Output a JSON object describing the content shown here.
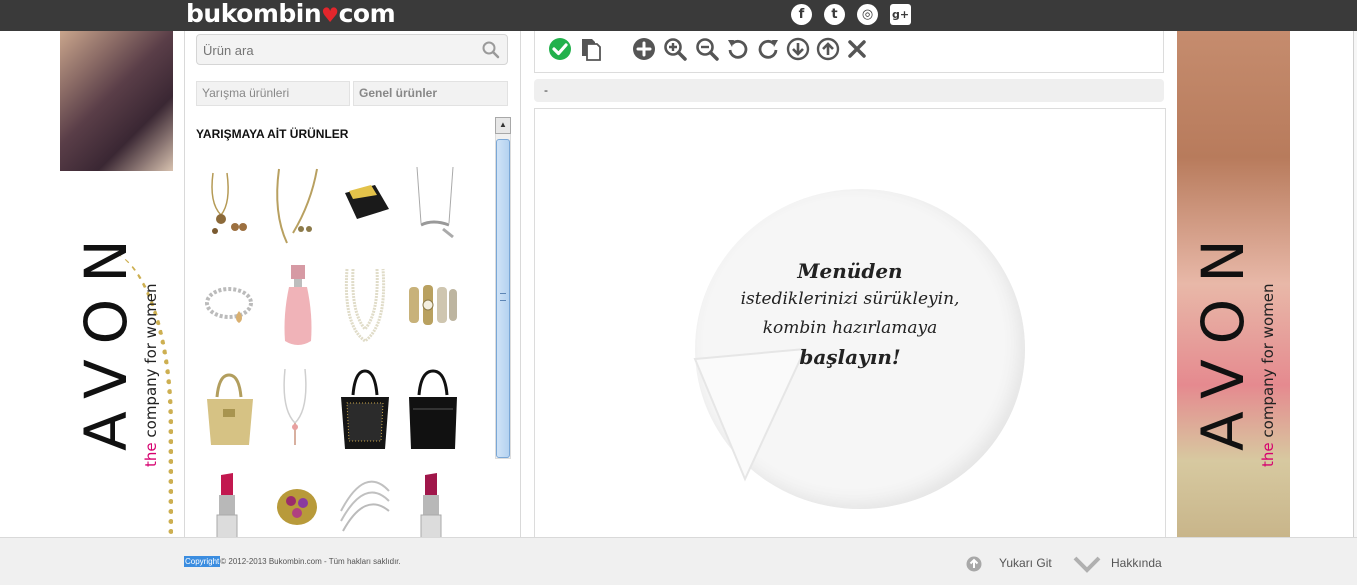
{
  "header": {
    "logo": {
      "part1": "bukombin",
      "heart": "♥",
      "part2": "com"
    },
    "social": [
      {
        "icon": "facebook-icon",
        "glyph": "f"
      },
      {
        "icon": "twitter-icon",
        "glyph": "t"
      },
      {
        "icon": "instagram-icon",
        "glyph": "◎"
      },
      {
        "icon": "google-plus-icon",
        "glyph": "g+"
      }
    ]
  },
  "banner": {
    "brand": "AVON",
    "the": "the",
    "tagline": " company for women"
  },
  "sidebar": {
    "search_placeholder": "Ürün ara",
    "tabs": [
      "Yarışma ürünleri",
      "Genel ürünler"
    ],
    "section_title": "YARIŞMAYA AİT ÜRÜNLER",
    "products": [
      {
        "icon": "necklace-earring-set-icon"
      },
      {
        "icon": "gold-necklace-set-icon"
      },
      {
        "icon": "wallet-icon"
      },
      {
        "icon": "silver-necklace-icon"
      },
      {
        "icon": "charm-bracelet-icon"
      },
      {
        "icon": "perfume-bottle-icon"
      },
      {
        "icon": "pearl-necklace-icon"
      },
      {
        "icon": "watch-bangle-set-icon"
      },
      {
        "icon": "beige-handbag-icon"
      },
      {
        "icon": "pendant-necklace-icon"
      },
      {
        "icon": "black-handbag-icon"
      },
      {
        "icon": "black-tote-bag-icon"
      },
      {
        "icon": "lipstick-icon"
      },
      {
        "icon": "gem-ring-icon"
      },
      {
        "icon": "multi-strand-necklace-icon"
      },
      {
        "icon": "lipstick-icon"
      }
    ]
  },
  "toolbar": {
    "tools": [
      {
        "name": "confirm-button",
        "icon": "check-icon"
      },
      {
        "name": "copy-button",
        "icon": "copy-icon"
      },
      {
        "name": "add-button",
        "icon": "plus-icon"
      },
      {
        "name": "zoom-in-button",
        "icon": "zoom-in-icon"
      },
      {
        "name": "zoom-out-button",
        "icon": "zoom-out-icon"
      },
      {
        "name": "rotate-left-button",
        "icon": "rotate-left-icon"
      },
      {
        "name": "rotate-right-button",
        "icon": "rotate-right-icon"
      },
      {
        "name": "send-backward-button",
        "icon": "arrow-down-icon"
      },
      {
        "name": "bring-forward-button",
        "icon": "arrow-up-icon"
      },
      {
        "name": "delete-button",
        "icon": "close-icon"
      }
    ],
    "status": "-"
  },
  "canvas": {
    "line1": "Menüden",
    "line2": "istediklerinizi sürükleyin,",
    "line3": "kombin hazırlamaya",
    "line4": "başlayın!"
  },
  "footer": {
    "copyright_word": "Copyright",
    "copyright_rest": "© 2012-2013 Bukombin.com - Tüm hakları saklıdır.",
    "back_to_top": "Yukarı Git",
    "about": "Hakkında"
  },
  "colors": {
    "topbar": "#3a3a3a",
    "accent_green": "#22b14c",
    "icon_gray": "#555555",
    "heart": "#e3262c",
    "avon_pink": "#d6006f"
  }
}
